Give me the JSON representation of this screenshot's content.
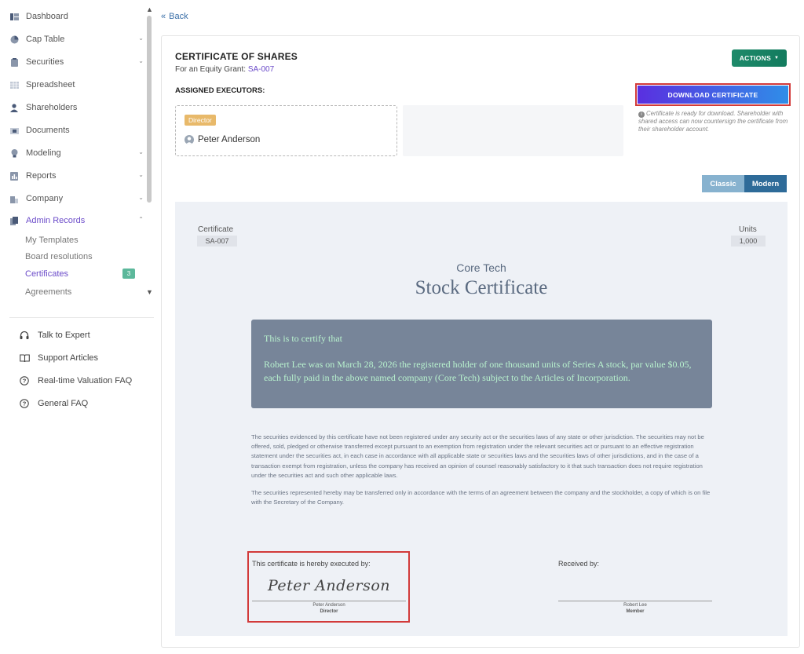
{
  "sidebar": {
    "items": [
      {
        "label": "Dashboard",
        "icon": "dashboard-icon"
      },
      {
        "label": "Cap Table",
        "icon": "pie-chart-icon"
      },
      {
        "label": "Securities",
        "icon": "clipboard-icon"
      },
      {
        "label": "Spreadsheet",
        "icon": "grid-icon"
      },
      {
        "label": "Shareholders",
        "icon": "user-icon"
      },
      {
        "label": "Documents",
        "icon": "folder-icon"
      },
      {
        "label": "Modeling",
        "icon": "bulb-icon"
      },
      {
        "label": "Reports",
        "icon": "report-icon"
      },
      {
        "label": "Company",
        "icon": "building-icon"
      },
      {
        "label": "Admin Records",
        "icon": "records-icon"
      }
    ],
    "sub_items": [
      {
        "label": "My Templates"
      },
      {
        "label": "Board resolutions"
      },
      {
        "label": "Certificates",
        "badge": "3"
      },
      {
        "label": "Agreements"
      }
    ],
    "help": [
      {
        "label": "Talk to Expert",
        "icon": "headset-icon"
      },
      {
        "label": "Support Articles",
        "icon": "book-icon"
      },
      {
        "label": "Real-time Valuation FAQ",
        "icon": "question-icon"
      },
      {
        "label": "General FAQ",
        "icon": "question-icon"
      }
    ],
    "active_color": "#6b4bc9",
    "badge_color": "#5cb89b"
  },
  "main": {
    "back_label": "Back",
    "title": "CERTIFICATE OF SHARES",
    "grant_prefix": "For an Equity Grant:",
    "grant_id": "SA-007",
    "executors_title": "ASSIGNED EXECUTORS:",
    "executor": {
      "role": "Director",
      "name": "Peter Anderson"
    },
    "actions_label": "ACTIONS",
    "download_label": "DOWNLOAD CERTIFICATE",
    "download_note": "Certificate is ready for download. Shareholder with shared access can now countersign the certificate from their shareholder account.",
    "toggle": {
      "classic": "Classic",
      "modern": "Modern",
      "selected": "Modern"
    }
  },
  "certificate": {
    "number_label": "Certificate",
    "number": "SA-007",
    "units_label": "Units",
    "units": "1,000",
    "company": "Core Tech",
    "heading": "Stock Certificate",
    "certify_head": "This is to certify that",
    "certify_body": "Robert Lee was on March 28, 2026 the registered holder of one thousand units of Series A stock, par value $0.05, each fully paid in the above named company (Core Tech) subject to the Articles of Incorporation.",
    "legal_1": "The securities evidenced by this certificate have not been registered under any security act or the securities laws of any state or other jurisdiction. The securities may not be offered, sold, pledged or otherwise transferred except pursuant to an exemption from registration under the relevant securities act or pursuant to an effective registration statement under the securities act, in each case in accordance with all applicable state or securities laws and the securities laws of other jurisdictions, and in the case of a transaction exempt from registration, unless the company has received an opinion of counsel reasonably satisfactory to it that such transaction does not require registration under the securities act and such other applicable laws.",
    "legal_2": "The securities represented hereby may be transferred only in accordance with the terms of an agreement between the company and the stockholder, a copy of which is on file with the Secretary of the Company.",
    "executed_label": "This certificate is hereby executed by:",
    "signature": "Peter Anderson",
    "signer_name": "Peter Anderson",
    "signer_role": "Director",
    "received_label": "Received by:",
    "receiver_name": "Robert Lee",
    "receiver_role": "Member",
    "text_color": "#b8f2ce",
    "box_color": "#778599"
  }
}
